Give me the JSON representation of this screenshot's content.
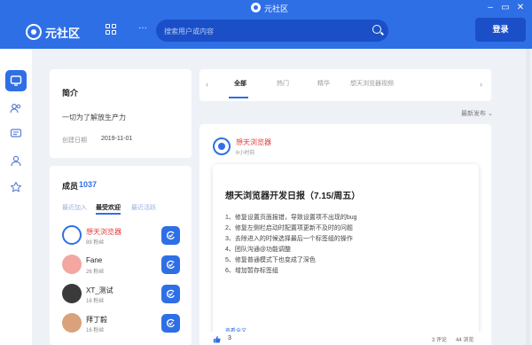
{
  "window": {
    "title": "元社区"
  },
  "header": {
    "brand": "元社区",
    "search_placeholder": "搜索用户或内容",
    "login_label": "登录",
    "more_label": "···"
  },
  "intro": {
    "heading": "简介",
    "description": "一切为了解放生产力",
    "created_label": "创建日期",
    "created_value": "2019-11-01"
  },
  "members": {
    "heading": "成员",
    "count": "1037",
    "tabs": [
      "最近加入",
      "最受欢迎",
      "最近活跃"
    ],
    "active_tab": "最受欢迎",
    "list": [
      {
        "name": "想天浏览器",
        "fans": "89 粉丝",
        "highlight": true,
        "avatar_color": "#2f6fe6"
      },
      {
        "name": "Fane",
        "fans": "26 粉丝",
        "highlight": false,
        "avatar_color": "#f3a7a0"
      },
      {
        "name": "XT_测试",
        "fans": "16 粉丝",
        "highlight": false,
        "avatar_color": "#3a3a3a"
      },
      {
        "name": "拜丁毅",
        "fans": "16 粉丝",
        "highlight": false,
        "avatar_color": "#d9a27a"
      }
    ]
  },
  "feed": {
    "tabs": [
      "全部",
      "热门",
      "精华",
      "想天浏览器视频"
    ],
    "active_tab": "全部",
    "sort_label": "最新发布"
  },
  "post": {
    "author": "想天浏览器",
    "time": "6小时前",
    "title": "想天浏览器开发日报（7.15/周五）",
    "lines": [
      "1、修复设置页面报错，导致设置项不出现的bug",
      "2、修复左侧栏启动时配置项更新不及时的问题",
      "3、去除进入的时候选择最后一个标签组的操作",
      "4、团队沟通@功能调整",
      "5、修复普通模式下也变成了深色",
      "6、增加暂存标签组"
    ],
    "read_more": "查看全文",
    "likes": "3",
    "comments": "3 评论",
    "views": "44 浏览"
  },
  "colors": {
    "accent": "#2f6fe6",
    "accent_dark": "#1a4fc7",
    "highlight_name": "#e23b3b"
  }
}
